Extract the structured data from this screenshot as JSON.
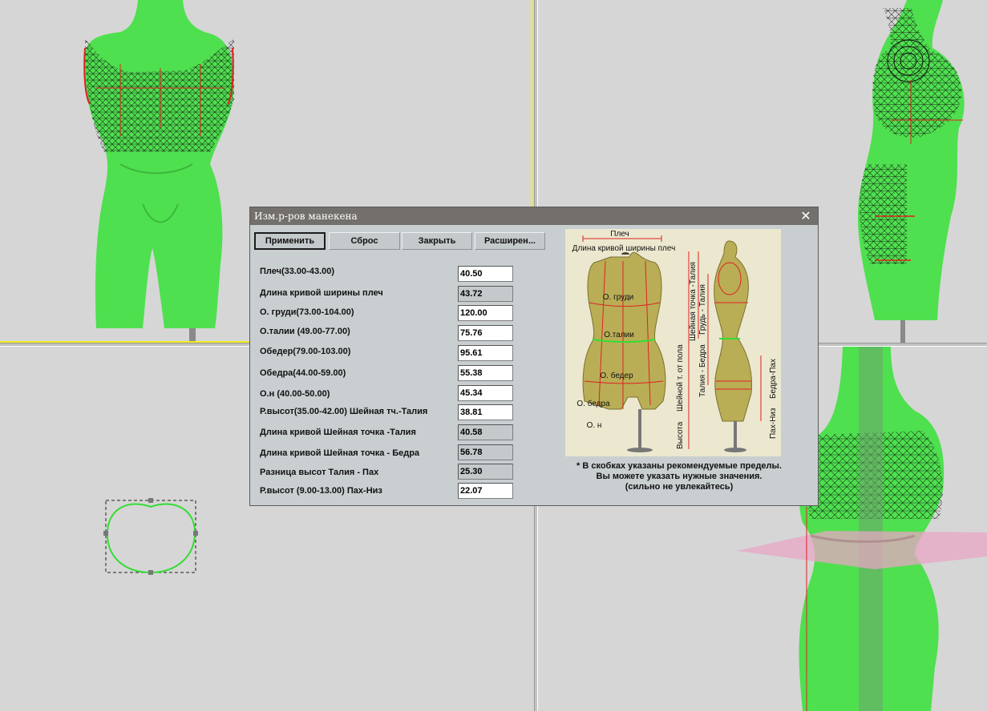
{
  "dialog": {
    "title": "Изм.р-ров манекена",
    "close_glyph": "✕",
    "buttons": {
      "apply": "Применить",
      "reset": "Сброс",
      "close": "Закрыть",
      "advanced": "Расширен..."
    },
    "rows": [
      {
        "label": "Плеч(33.00-43.00)",
        "value": "40.50",
        "editable": true
      },
      {
        "label": "Длина кривой ширины плеч",
        "value": "43.72",
        "editable": false
      },
      {
        "label": "О. груди(73.00-104.00)",
        "value": "120.00",
        "editable": true
      },
      {
        "label": "О.талии (49.00-77.00)",
        "value": "75.76",
        "editable": true
      },
      {
        "label": "Обедер(79.00-103.00)",
        "value": "95.61",
        "editable": true
      },
      {
        "label": "Обедра(44.00-59.00)",
        "value": "55.38",
        "editable": true
      },
      {
        "label": "О.н (40.00-50.00)",
        "value": "45.34",
        "editable": true
      },
      {
        "label": "Р.высот(35.00-42.00) Шейная тч.-Талия",
        "value": "38.81",
        "editable": true
      },
      {
        "label": "Длина кривой Шейная точка -Талия",
        "value": "40.58",
        "editable": false
      },
      {
        "label": "Длина кривой Шейная точка - Бедра",
        "value": "56.78",
        "editable": false
      },
      {
        "label": "Разница высот Талия - Пах",
        "value": "25.30",
        "editable": false
      },
      {
        "label": "Р.высот (9.00-13.00) Пах-Низ",
        "value": "22.07",
        "editable": true
      }
    ],
    "illustration": {
      "front_labels": {
        "shoulder": "Плеч",
        "shoulder_curve": "Длина кривой ширины плеч",
        "bust": "О. груди",
        "waist": "О.талии",
        "hips": "О. бедер",
        "thigh": "О. бедра",
        "knee": "О. н"
      },
      "side_labels": {
        "height": "Высота",
        "neck_from_floor": "Шейной т. от пола",
        "neck_waist": "Шейная точка -Талия",
        "chest_waist": "Грудь - Талия",
        "waist_hips": "Талия - Бедра",
        "hips_crotch": "Бедра-Пах",
        "crotch_bottom": "Пах-Низ"
      }
    },
    "note": [
      "*  В скобках указаны  рекомендуемые пределы.",
      "Вы можете указать  нужные значения.",
      "(сильно не увлекайтесь)"
    ]
  },
  "colors": {
    "viewport_bg": "#d6d6d6",
    "mannequin_green": "#4fe04f",
    "wireframe": "#111111",
    "highlight_red": "#e02020",
    "axis_yellow": "#f2ee1a",
    "titlebar": "#73706b",
    "dialog_bg": "#c9ced1",
    "plane_pink": "#e8a6c4"
  }
}
